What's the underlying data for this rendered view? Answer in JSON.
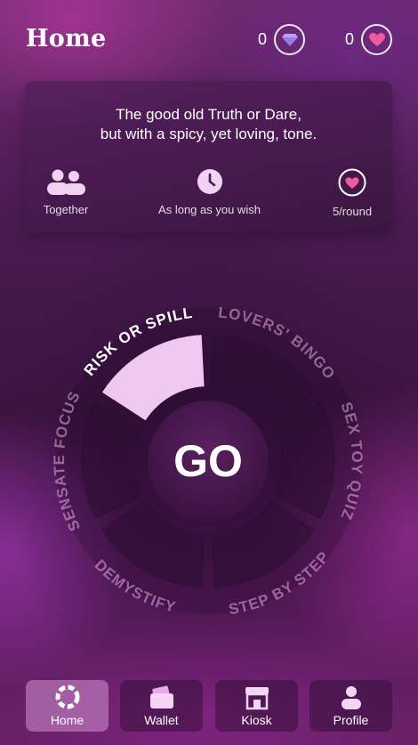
{
  "header": {
    "title": "Home",
    "gems": "0",
    "hearts": "0"
  },
  "card": {
    "line1": "The good old Truth or Dare,",
    "line2": "but with a spicy, yet loving, tone.",
    "features": [
      {
        "icon": "couple-icon",
        "label": "Together"
      },
      {
        "icon": "clock-icon",
        "label": "As long as you wish"
      },
      {
        "icon": "heart-icon",
        "label": "5/round"
      }
    ]
  },
  "wheel": {
    "go_label": "GO",
    "games": [
      {
        "label": "RISK OR SPILL",
        "selected": true
      },
      {
        "label": "LOVERS' BINGO",
        "selected": false
      },
      {
        "label": "SEX TOY QUIZ",
        "selected": false
      },
      {
        "label": "STEP BY STEP",
        "selected": false
      },
      {
        "label": "DEMYSTIFY",
        "selected": false
      },
      {
        "label": "SENSATE FOCUS",
        "selected": false
      }
    ]
  },
  "tabs": [
    {
      "label": "Home",
      "icon": "home-ring-icon",
      "active": true
    },
    {
      "label": "Wallet",
      "icon": "wallet-icon",
      "active": false
    },
    {
      "label": "Kiosk",
      "icon": "kiosk-icon",
      "active": false
    },
    {
      "label": "Profile",
      "icon": "profile-icon",
      "active": false
    }
  ],
  "colors": {
    "selected_segment": "#f0c8ef",
    "segment": "#2e0f33",
    "heart": "#f05aa0",
    "gem": "#9b7be6"
  }
}
